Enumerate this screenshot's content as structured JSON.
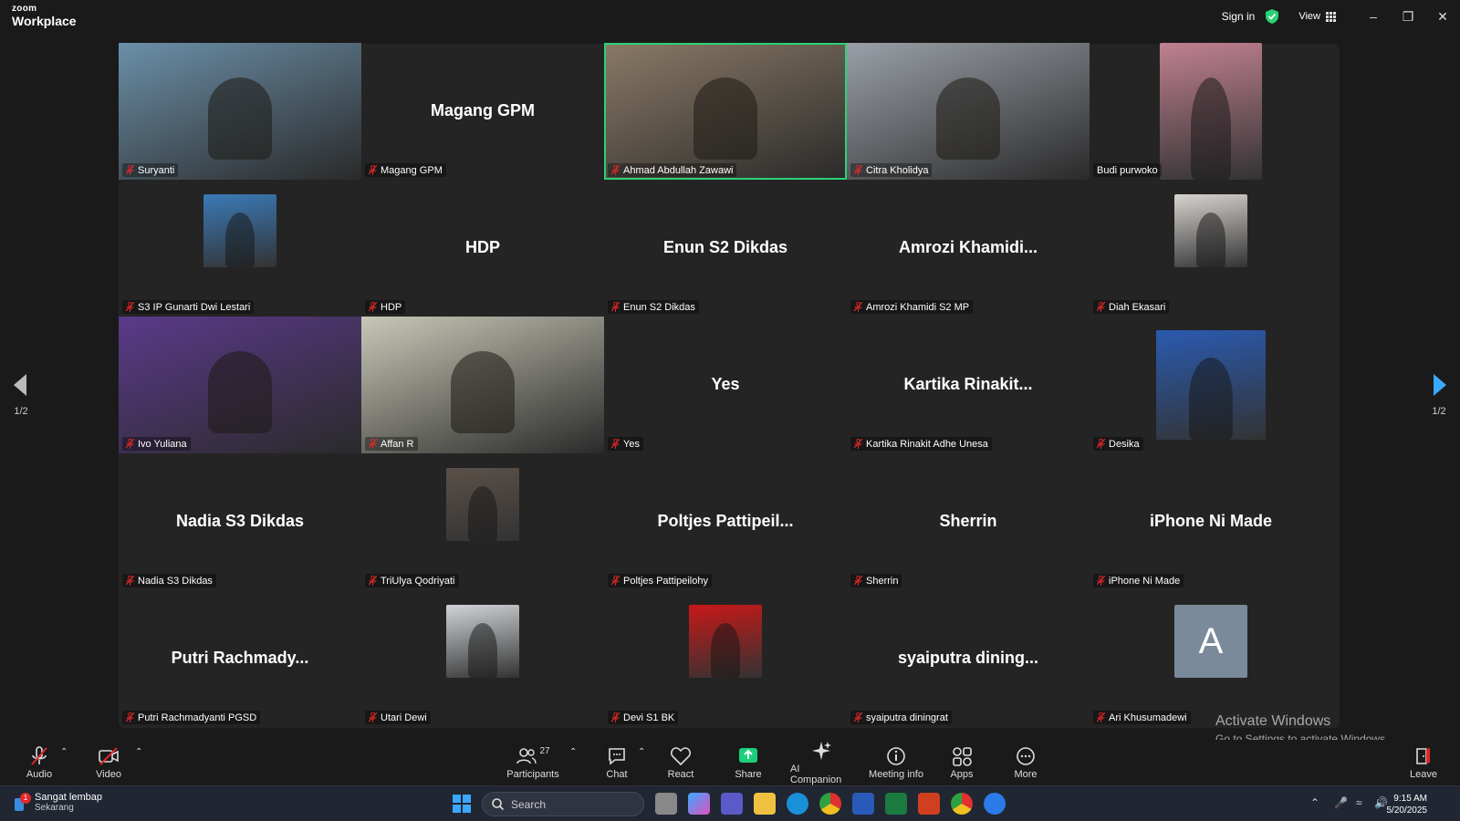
{
  "app": {
    "logo_small": "zoom",
    "logo_big": "Workplace"
  },
  "titlebar": {
    "signin": "Sign in",
    "view": "View"
  },
  "tiles": [
    {
      "name": "Suryanti",
      "kind": "video",
      "bg": "#6b8fa8"
    },
    {
      "name": "Magang GPM",
      "big": "Magang GPM",
      "kind": "name"
    },
    {
      "name": "Ahmad Abdullah Zawawi",
      "kind": "video",
      "bg": "#8a7a66",
      "active": true
    },
    {
      "name": "Citra Kholidya",
      "kind": "video",
      "bg": "#9aa0a8"
    },
    {
      "name": "Budi purwoko",
      "kind": "thumbwide",
      "bg": "#c08090"
    },
    {
      "name": "S3 IP Gunarti Dwi Lestari",
      "kind": "thumb",
      "bg": "#3a7ab8"
    },
    {
      "name": "HDP",
      "big": "HDP",
      "kind": "name"
    },
    {
      "name": "Enun S2 Dikdas",
      "big": "Enun S2 Dikdas",
      "kind": "name"
    },
    {
      "name": "Amrozi Khamidi S2 MP",
      "big": "Amrozi  Khamidi...",
      "kind": "name"
    },
    {
      "name": "Diah Ekasari",
      "kind": "thumb",
      "bg": "#d8d4d0"
    },
    {
      "name": "Ivo Yuliana",
      "kind": "video",
      "bg": "#5a3a8a"
    },
    {
      "name": "Affan R",
      "kind": "video",
      "bg": "#c8c8b8"
    },
    {
      "name": "Yes",
      "big": "Yes",
      "kind": "name"
    },
    {
      "name": "Kartika Rinakit Adhe Unesa",
      "big": "Kartika  Rinakit...",
      "kind": "name"
    },
    {
      "name": "Desika",
      "kind": "thumbbig",
      "bg": "#2a5ab0"
    },
    {
      "name": "Nadia S3 Dikdas",
      "big": "Nadia S3 Dikdas",
      "kind": "name"
    },
    {
      "name": "TriUlya Qodriyati",
      "kind": "thumb",
      "bg": "#5a5048"
    },
    {
      "name": "Poltjes Pattipeilohy",
      "big": "Poltjes  Pattipeil...",
      "kind": "name"
    },
    {
      "name": "Sherrin",
      "big": "Sherrin",
      "kind": "name"
    },
    {
      "name": "iPhone Ni Made",
      "big": "iPhone Ni Made",
      "kind": "name"
    },
    {
      "name": "Putri Rachmadyanti PGSD",
      "big": "Putri  Rachmady...",
      "kind": "name"
    },
    {
      "name": "Utari Dewi",
      "kind": "thumb",
      "bg": "#d0d4d8"
    },
    {
      "name": "Devi S1 BK",
      "kind": "thumb",
      "bg": "#c81818"
    },
    {
      "name": "syaiputra diningrat",
      "big": "syaiputra  dining...",
      "kind": "name"
    },
    {
      "name": "Ari Khusumadewi",
      "kind": "letter",
      "letter": "A",
      "bg": "#7a8a9a"
    }
  ],
  "nav": {
    "page": "1/2"
  },
  "toolbar": {
    "audio": "Audio",
    "video": "Video",
    "participants": "Participants",
    "participants_count": "27",
    "chat": "Chat",
    "react": "React",
    "share": "Share",
    "ai": "AI Companion",
    "info": "Meeting info",
    "apps": "Apps",
    "more": "More",
    "leave": "Leave"
  },
  "watermark": {
    "line1": "Activate Windows",
    "line2": "Go to Settings to activate Windows."
  },
  "taskbar": {
    "notif_badge": "1",
    "notif_title": "Sangat lembap",
    "notif_sub": "Sekarang",
    "search": "Search",
    "time": "9:15 AM",
    "date": "5/20/2025"
  },
  "colors": {
    "active": "#2bd176",
    "share": "#1bd07c",
    "mute": "#e02828"
  }
}
